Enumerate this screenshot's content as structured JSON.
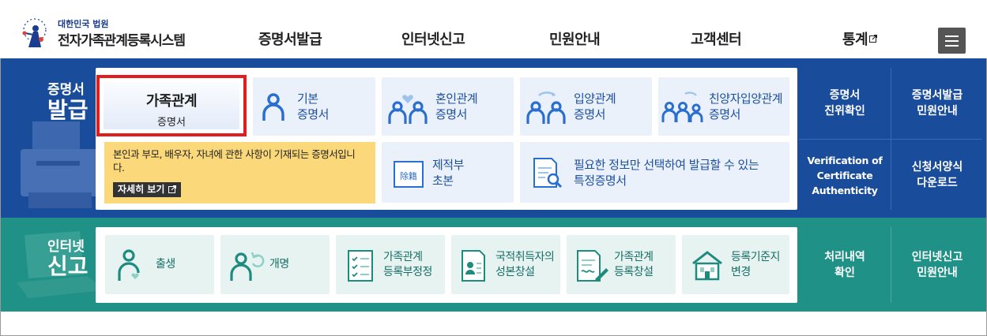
{
  "header": {
    "brand_small": "대한민국 법원",
    "brand_title": "전자가족관계등록시스템",
    "nav": [
      "증명서발급",
      "인터넷신고",
      "민원안내",
      "고객센터",
      "통계"
    ]
  },
  "certificate_section": {
    "title_line1": "증명서",
    "title_line2": "발급",
    "active_card": {
      "line1": "가족관계",
      "line2": "증명서"
    },
    "description": "본인과 부모, 배우자, 자녀에 관한 사항이 기재되는 증명서입니다.",
    "detail_button": "자세히 보기",
    "cards": [
      {
        "line1": "기본",
        "line2": "증명서",
        "icon": "person-icon"
      },
      {
        "line1": "혼인관계",
        "line2": "증명서",
        "icon": "couple-heart-icon"
      },
      {
        "line1": "입양관계",
        "line2": "증명서",
        "icon": "adoption-icon"
      },
      {
        "line1": "친양자입양관계",
        "line2": "증명서",
        "icon": "family-adoption-icon"
      },
      {
        "line1": "제적부",
        "line2": "초본",
        "icon": "register-book-icon"
      },
      {
        "line1": "필요한 정보만 선택하여 발급할 수 있는",
        "line2": "특정증명서",
        "icon": "document-search-icon"
      }
    ],
    "side_links": [
      {
        "line1": "증명서",
        "line2": "진위확인"
      },
      {
        "line1": "증명서발급",
        "line2": "민원안내"
      },
      {
        "line1": "Verification of",
        "line2": "Certificate",
        "line3": "Authenticity"
      },
      {
        "line1": "신청서양식",
        "line2": "다운로드"
      }
    ]
  },
  "report_section": {
    "title_line1": "인터넷",
    "title_line2": "신고",
    "cards": [
      {
        "line1": "출생",
        "line2": "",
        "icon": "baby-icon"
      },
      {
        "line1": "개명",
        "line2": "",
        "icon": "rename-icon"
      },
      {
        "line1": "가족관계",
        "line2": "등록부정정",
        "icon": "checklist-icon"
      },
      {
        "line1": "국적취득자의",
        "line2": "성본창설",
        "icon": "id-document-icon"
      },
      {
        "line1": "가족관계",
        "line2": "등록창설",
        "icon": "document-pen-icon"
      },
      {
        "line1": "등록기준지",
        "line2": "변경",
        "icon": "house-icon"
      }
    ],
    "side_links": [
      {
        "line1": "처리내역",
        "line2": "확인"
      },
      {
        "line1": "인터넷신고",
        "line2": "민원안내"
      }
    ]
  },
  "colors": {
    "blue_band": "#1a4c9c",
    "green_band": "#1f9186",
    "highlight_border": "#e11d1d",
    "description_bg": "#fbd97a"
  }
}
